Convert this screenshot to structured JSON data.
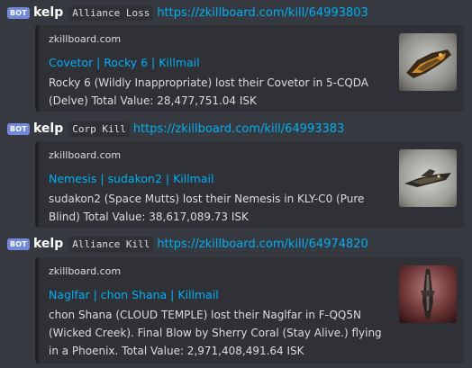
{
  "messages": [
    {
      "bot_tag": "BOT",
      "username": "kelp",
      "tag": "Alliance Loss",
      "link": "https://zkillboard.com/kill/64993803",
      "embed": {
        "provider": "zkillboard.com",
        "title": "Covetor | Rocky 6 | Killmail",
        "description": "Rocky 6 (Wildly Inappropriate) lost their Covetor in 5-CQDA (Delve) Total Value: 28,477,751.04 ISK",
        "thumbnail": "covetor-ship-thumbnail"
      }
    },
    {
      "bot_tag": "BOT",
      "username": "kelp",
      "tag": "Corp Kill",
      "link": "https://zkillboard.com/kill/64993383",
      "embed": {
        "provider": "zkillboard.com",
        "title": "Nemesis | sudakon2 | Killmail",
        "description": "sudakon2 (Space Mutts) lost their Nemesis in KLY-C0 (Pure Blind) Total Value: 38,617,089.73 ISK",
        "thumbnail": "nemesis-ship-thumbnail"
      }
    },
    {
      "bot_tag": "BOT",
      "username": "kelp",
      "tag": "Alliance Kill",
      "link": "https://zkillboard.com/kill/64974820",
      "embed": {
        "provider": "zkillboard.com",
        "title": "Naglfar | chon Shana | Killmail",
        "description": "chon Shana (CLOUD TEMPLE) lost their Naglfar in F-QQ5N (Wicked Creek). Final Blow by Sherry Coral (Stay Alive.) flying in a Phoenix. Total Value: 2,971,408,491.64 ISK",
        "thumbnail": "naglfar-ship-thumbnail"
      }
    }
  ]
}
